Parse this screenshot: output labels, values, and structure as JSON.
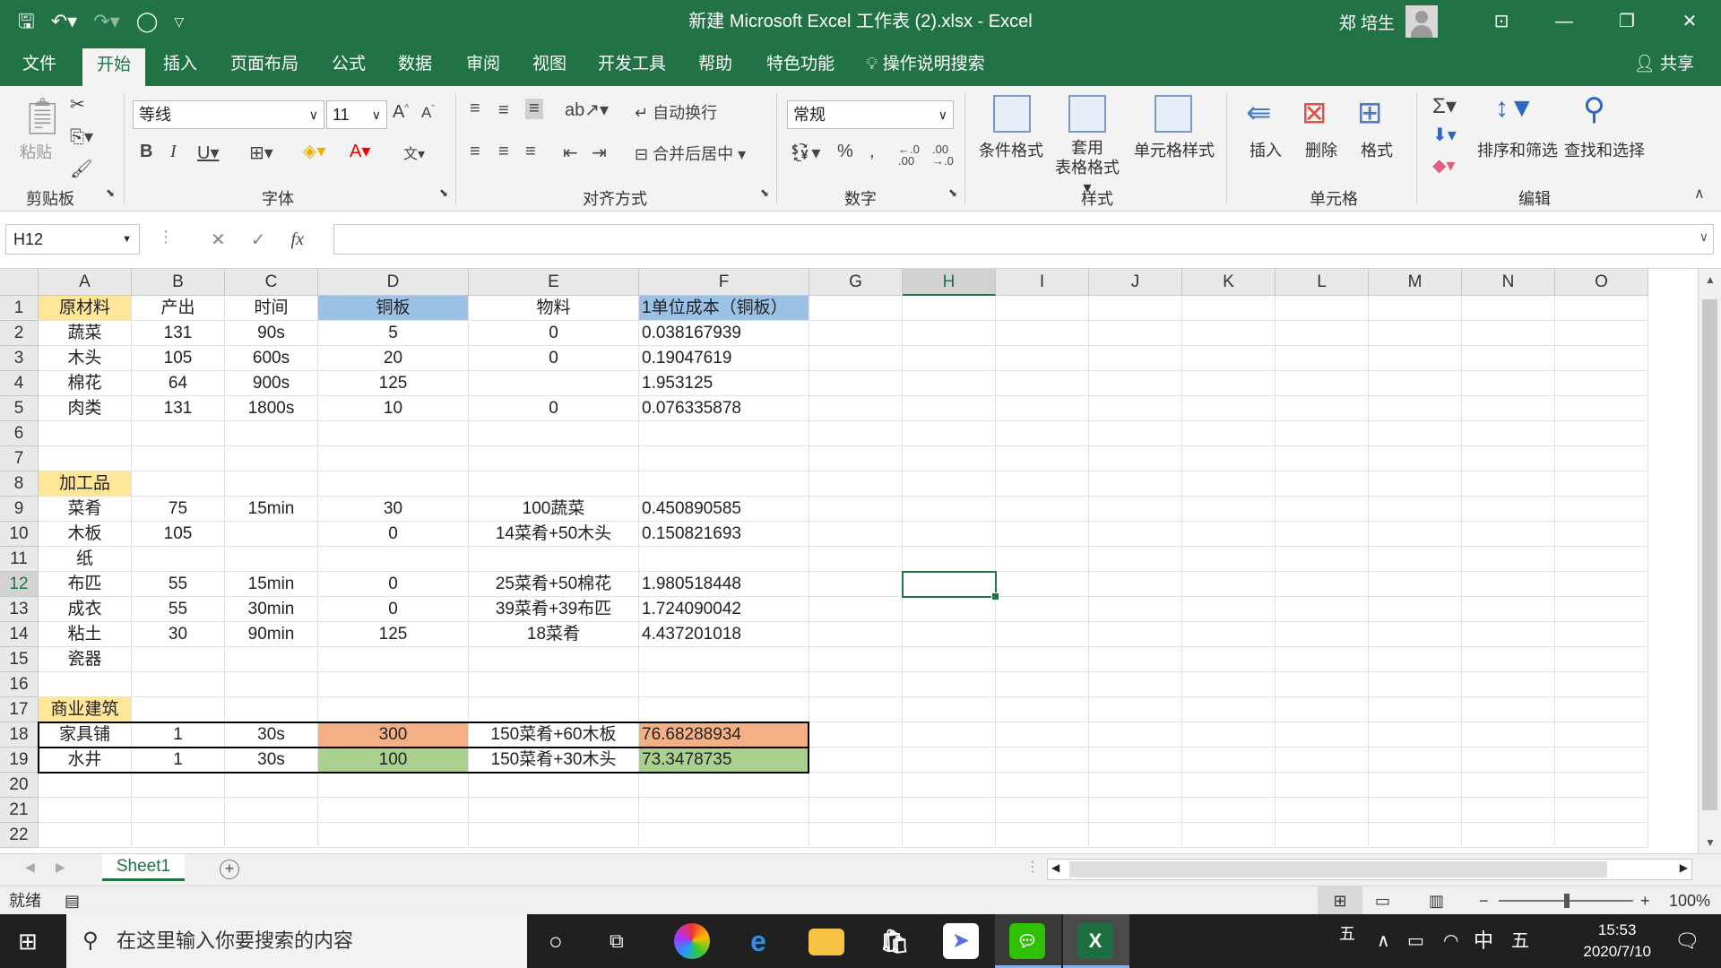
{
  "titlebar": {
    "title": "新建 Microsoft Excel 工作表 (2).xlsx  -  Excel",
    "user": "郑 培生"
  },
  "tabs": [
    "文件",
    "开始",
    "插入",
    "页面布局",
    "公式",
    "数据",
    "审阅",
    "视图",
    "开发工具",
    "帮助",
    "特色功能",
    "操作说明搜索"
  ],
  "share_label": "共享",
  "ribbon": {
    "paste": "粘贴",
    "font_name": "等线",
    "font_size": "11",
    "wrap_text": "自动换行",
    "merge_center": "合并后居中",
    "number_format": "常规",
    "cond_format": "条件格式",
    "table_format_1": "套用",
    "table_format_2": "表格格式",
    "cell_style": "单元格样式",
    "insert": "插入",
    "delete": "删除",
    "format": "格式",
    "sort_filter": "排序和筛选",
    "find_select": "查找和选择",
    "groups": [
      "剪贴板",
      "字体",
      "对齐方式",
      "数字",
      "样式",
      "单元格",
      "编辑"
    ]
  },
  "formula_bar": {
    "name_box": "H12",
    "value": ""
  },
  "columns": [
    "A",
    "B",
    "C",
    "D",
    "E",
    "F",
    "G",
    "H",
    "I",
    "J",
    "K",
    "L",
    "M",
    "N",
    "O"
  ],
  "rows": [
    [
      "原材料",
      "产出",
      "时间",
      "铜板",
      "物料",
      "1单位成本（铜板）"
    ],
    [
      "蔬菜",
      "131",
      "90s",
      "5",
      "0",
      "0.038167939"
    ],
    [
      "木头",
      "105",
      "600s",
      "20",
      "0",
      "0.19047619"
    ],
    [
      "棉花",
      "64",
      "900s",
      "125",
      "",
      "1.953125"
    ],
    [
      "肉类",
      "131",
      "1800s",
      "10",
      "0",
      "0.076335878"
    ],
    [
      "",
      "",
      "",
      "",
      "",
      ""
    ],
    [
      "",
      "",
      "",
      "",
      "",
      ""
    ],
    [
      "加工品",
      "",
      "",
      "",
      "",
      ""
    ],
    [
      "菜肴",
      "75",
      "15min",
      "30",
      "100蔬菜",
      "0.450890585"
    ],
    [
      "木板",
      "105",
      "",
      "0",
      "14菜肴+50木头",
      "0.150821693"
    ],
    [
      "纸",
      "",
      "",
      "",
      "",
      ""
    ],
    [
      "布匹",
      "55",
      "15min",
      "0",
      "25菜肴+50棉花",
      "1.980518448"
    ],
    [
      "成衣",
      "55",
      "30min",
      "0",
      "39菜肴+39布匹",
      "1.724090042"
    ],
    [
      "粘土",
      "30",
      "90min",
      "125",
      "18菜肴",
      "4.437201018"
    ],
    [
      "瓷器",
      "",
      "",
      "",
      "",
      ""
    ],
    [
      "",
      "",
      "",
      "",
      "",
      ""
    ],
    [
      "商业建筑",
      "",
      "",
      "",
      "",
      ""
    ],
    [
      "家具铺",
      "1",
      "30s",
      "300",
      "150菜肴+60木板",
      "76.68288934"
    ],
    [
      "水井",
      "1",
      "30s",
      "100",
      "150菜肴+30木头",
      "73.3478735"
    ],
    [
      "",
      "",
      "",
      "",
      "",
      ""
    ],
    [
      "",
      "",
      "",
      "",
      "",
      ""
    ],
    [
      "",
      "",
      "",
      "",
      "",
      ""
    ]
  ],
  "sheet_tab": "Sheet1",
  "status": {
    "ready": "就绪",
    "zoom": "100%"
  },
  "taskbar": {
    "search_placeholder": "在这里输入你要搜索的内容",
    "time": "15:53",
    "date": "2020/7/10",
    "ime_1": "五",
    "ime_lang": "中",
    "ime_2": "五"
  },
  "colors": {
    "excel_green": "#217346",
    "yellow": "#ffe699",
    "blue": "#9bc2e6",
    "orange": "#f4b084",
    "green": "#a9d08e"
  }
}
